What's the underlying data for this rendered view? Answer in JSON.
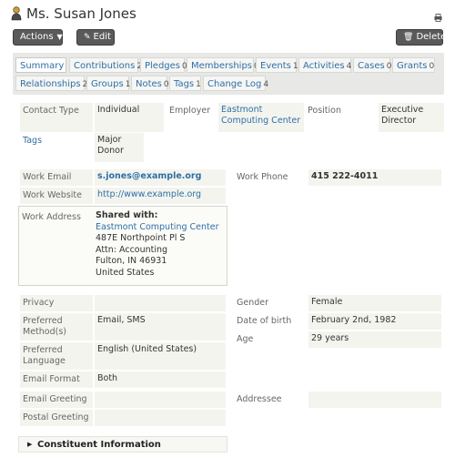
{
  "header": {
    "title": "Ms. Susan Jones"
  },
  "toolbar": {
    "actions_label": "Actions",
    "edit_label": "Edit",
    "delete_label": "Delete"
  },
  "tabs": [
    {
      "label": "Summary",
      "count": ""
    },
    {
      "label": "Contributions",
      "count": "2"
    },
    {
      "label": "Pledges",
      "count": "0"
    },
    {
      "label": "Memberships",
      "count": "0"
    },
    {
      "label": "Events",
      "count": "1"
    },
    {
      "label": "Activities",
      "count": "4"
    },
    {
      "label": "Cases",
      "count": "0"
    },
    {
      "label": "Grants",
      "count": "0"
    },
    {
      "label": "Relationships",
      "count": "2"
    },
    {
      "label": "Groups",
      "count": "1"
    },
    {
      "label": "Notes",
      "count": "0"
    },
    {
      "label": "Tags",
      "count": "1"
    },
    {
      "label": "Change Log",
      "count": "4"
    }
  ],
  "basic": {
    "contact_type_label": "Contact Type",
    "contact_type_value": "Individual",
    "employer_label": "Employer",
    "employer_value": "Eastmont Computing Center",
    "position_label": "Position",
    "position_value": "Executive Director",
    "tags_label": "Tags",
    "tags_value": "Major Donor"
  },
  "contact": {
    "work_email_label": "Work Email",
    "work_email_value": "s.jones@example.org",
    "work_phone_label": "Work Phone",
    "work_phone_value": "415 222-4011",
    "work_website_label": "Work Website",
    "work_website_value": "http://www.example.org",
    "work_address_label": "Work Address",
    "shared_with_label": "Shared with:",
    "shared_with_value": "Eastmont Computing Center",
    "address_line1": "487E Northpoint Pl S",
    "address_line2": "Attn: Accounting",
    "address_line3": "Fulton, IN 46931",
    "address_line4": "United States"
  },
  "prefs": {
    "privacy_label": "Privacy",
    "privacy_value": "",
    "preferred_method_label": "Preferred Method(s)",
    "preferred_method_value": "Email, SMS",
    "preferred_language_label": "Preferred Language",
    "preferred_language_value": "English (United States)",
    "email_format_label": "Email Format",
    "email_format_value": "Both",
    "gender_label": "Gender",
    "gender_value": "Female",
    "dob_label": "Date of birth",
    "dob_value": "February 2nd, 1982",
    "age_label": "Age",
    "age_value": "29 years"
  },
  "greetings": {
    "email_greeting_label": "Email Greeting",
    "email_greeting_value": "",
    "postal_greeting_label": "Postal Greeting",
    "postal_greeting_value": "",
    "addressee_label": "Addressee",
    "addressee_value": ""
  },
  "accordion": {
    "title": "Constituent Information"
  },
  "icons": {
    "person": "person-icon",
    "print": "print-icon",
    "edit": "pencil-icon",
    "delete": "trash-icon",
    "actions_caret": "chevron-down-icon",
    "accordion_toggle": "triangle-right-icon"
  }
}
